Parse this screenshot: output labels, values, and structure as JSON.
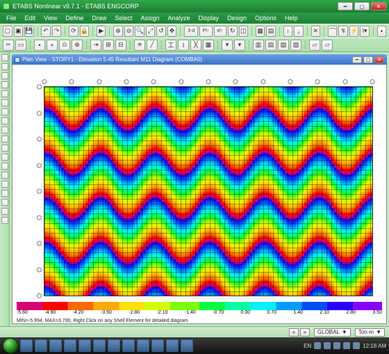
{
  "title": "ETABS Nonlinear v9.7.1 - ETABS ENGCORP",
  "menu": [
    "File",
    "Edit",
    "View",
    "Define",
    "Draw",
    "Select",
    "Assign",
    "Analyze",
    "Display",
    "Design",
    "Options",
    "Help"
  ],
  "doc_title": "Plan View - STORY1 - Elevation 5.45   Resultant M11 Diagram   (COMBA0)",
  "colorbar": {
    "ticks": [
      "-5.60",
      "-4.90",
      "-4.20",
      "-3.50",
      "-2.80",
      "-2.10",
      "-1.40",
      "-0.70",
      "0.00",
      "0.70",
      "1.40",
      "2.10",
      "2.80",
      "3.50"
    ]
  },
  "hint": "MIN=-5.994, MAX=3.700, Right Click on any Shell Element for detailed diagram",
  "status": {
    "coord_sys": "GLOBAL",
    "units": "Ton-m"
  },
  "taskbar": {
    "lang": "EN",
    "time": "12:18 AM"
  },
  "grid": {
    "cols": 13,
    "rows": 9
  }
}
